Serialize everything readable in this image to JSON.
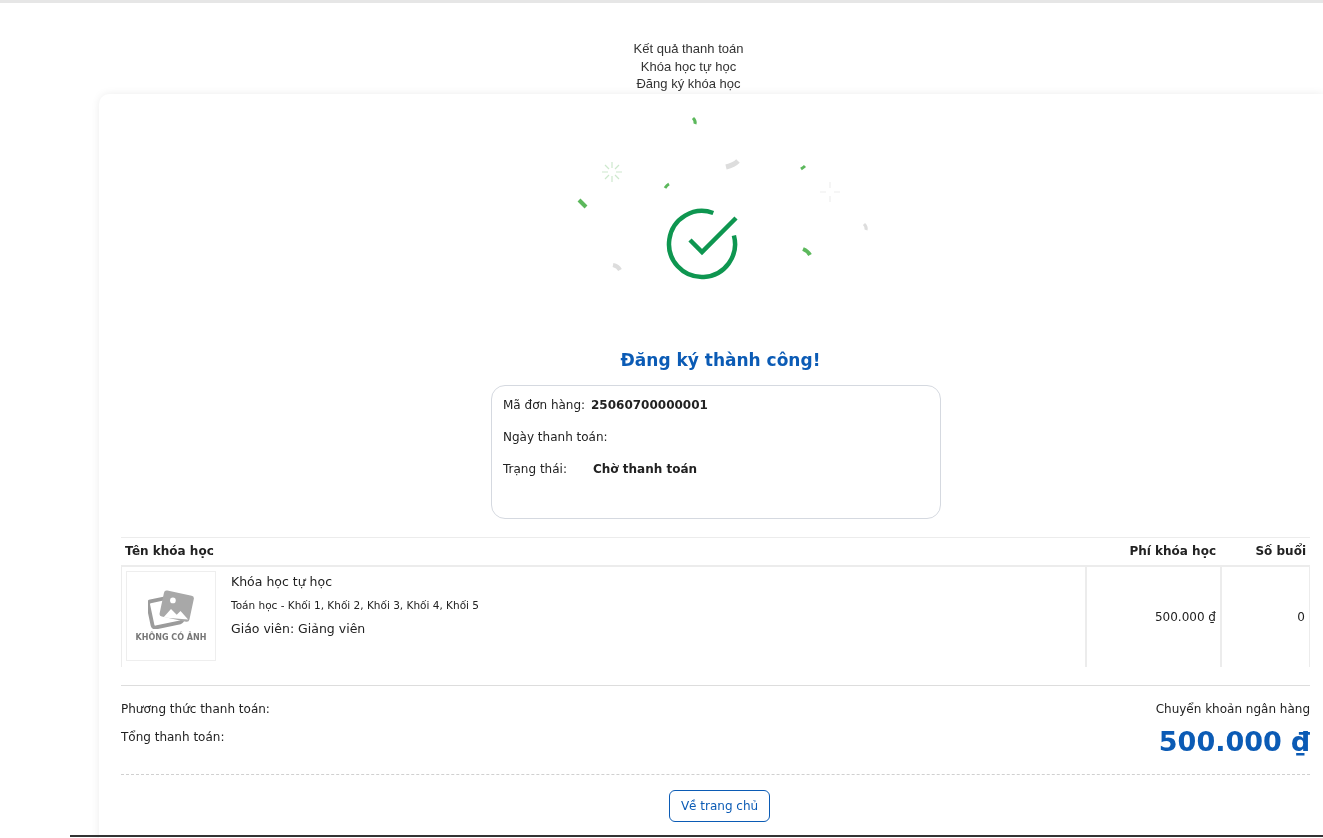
{
  "breadcrumb": [
    "Kết quả thanh toán",
    "Khóa học tự học",
    "Đăng ký khóa học"
  ],
  "result": {
    "title": "Đăng ký thành công!"
  },
  "order": [
    {
      "label": "Mã đơn hàng:",
      "value": "25060700000001"
    },
    {
      "label": "Ngày thanh toán:"
    },
    {
      "label": "Trạng thái:",
      "value": "Chờ thanh toán"
    }
  ],
  "table": {
    "columns": [
      "Tên khóa học",
      "Phí khóa học",
      "Số buổi"
    ],
    "rows": [
      {
        "image_text": "KHÔNG CÓ ẢNH",
        "name": "Khóa học tự học",
        "subjects": "Toán học - Khối 1, Khối 2, Khối 3, Khối 4, Khối 5",
        "teacher": "Giáo viên: Giảng viên",
        "fee": "500.000 ₫",
        "sessions": "0"
      }
    ]
  },
  "payment": {
    "method_label": "Phương thức thanh toán:",
    "method": "Chuyển khoản ngân hàng",
    "total_label": "Tổng thanh toán:",
    "total": "500.000 ₫"
  },
  "home_button": "Về trang chủ"
}
